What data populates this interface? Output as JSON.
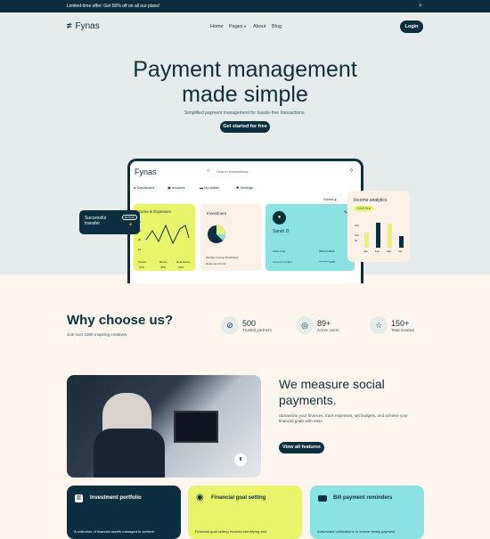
{
  "banner": {
    "text": "Limited-time offer: Get 50% off on all our plans!",
    "close": "×"
  },
  "nav": {
    "brand": "Fynas",
    "links": [
      "Home",
      "Pages",
      "About",
      "Blog"
    ],
    "login": "Login"
  },
  "hero": {
    "title_line1": "Payment management",
    "title_line2": "made simple",
    "subtitle": "Simplified payment management for hassle-free transactions.",
    "cta": "Get started for free"
  },
  "dashboard": {
    "brand": "Fynas",
    "search_placeholder": "Search transactions...",
    "menu": [
      "Dashboard",
      "Invoices",
      "My wallet",
      "Settings"
    ],
    "sort": "Saved",
    "income_expenses": {
      "title": "Income & Expenses",
      "y_ticks": [
        "4k",
        "3k",
        "2k",
        "1k"
      ],
      "labels": [
        "Stocks",
        "Bonds",
        "Real Estate"
      ],
      "values": [
        "33%",
        "38%",
        "33%"
      ]
    },
    "investment": {
      "title": "Investment",
      "items": [
        "Monthly Income Breakdown",
        "Retirement Fund"
      ]
    },
    "profile": {
      "name": "Sarah D",
      "fields": [
        {
          "label": "IFSC code",
          "value": "#BD0723098"
        },
        {
          "label": "Account number",
          "value": "**********3456"
        }
      ]
    },
    "analytics": {
      "title": "Income analytics",
      "badge": "+10.5 %",
      "y_ticks": [
        "20k",
        "10k",
        "5k"
      ],
      "months": [
        "Jan",
        "Feb",
        "Mar",
        "Apr"
      ],
      "values": [
        0.6,
        1.0,
        0.95,
        0.45
      ],
      "colors": [
        "#e8f56a",
        "#0b2f3e",
        "#e8f56a",
        "#0b2f3e"
      ]
    },
    "transfer": {
      "label": "Successful transfer",
      "amount": "$175.00"
    }
  },
  "why": {
    "title": "Why choose us?",
    "subtitle": "Join over 100K inspiring creatives.",
    "stats": [
      {
        "icon": "compass-icon",
        "value": "500",
        "label": "Trusted partners"
      },
      {
        "icon": "target-icon",
        "value": "89+",
        "label": "Active users"
      },
      {
        "icon": "star-icon",
        "value": "150+",
        "label": "Total reviews"
      }
    ]
  },
  "social": {
    "title_line1": "We measure social",
    "title_line2": "payments.",
    "text": "Streamline your finances, track expenses, set budgets, and achieve your financial goals with ease.",
    "cta": "View all features",
    "pause": "II"
  },
  "features": [
    {
      "title": "Investment portfolio",
      "desc": "A collection of financial assets managed to achieve",
      "bg": "#0b2f3e"
    },
    {
      "title": "Financial goal setting",
      "desc": "Financial goal setting involves identifying and",
      "bg": "#e8f56a"
    },
    {
      "title": "Bill payment reminders",
      "desc": "Automated notifications to ensure timely payment",
      "bg": "#8ae3e0"
    }
  ]
}
